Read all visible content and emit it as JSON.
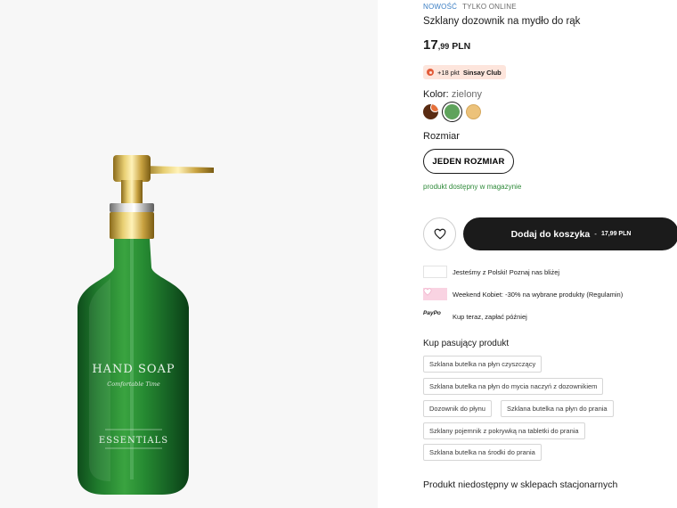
{
  "product": {
    "tag_new": "NOWOŚĆ",
    "tag_online": "TYLKO ONLINE",
    "title": "Szklany dozownik na mydło do rąk",
    "price_int": "17",
    "price_dec": ",99",
    "currency": "PLN",
    "points_text": "+18 pkt",
    "points_club": "Sinsay Club",
    "color_label": "Kolor:",
    "color_value": "zielony",
    "colors": [
      {
        "name": "brown",
        "hex": "#5a2b12"
      },
      {
        "name": "green",
        "hex": "#5fa35c",
        "selected": true
      },
      {
        "name": "sand",
        "hex": "#ecc27a"
      }
    ],
    "size_label": "Rozmiar",
    "size_option": "JEDEN ROZMIAR",
    "stock_text": "produkt dostępny w magazynie",
    "cart_label": "Dodaj do koszyka",
    "cart_separator": "-",
    "cart_price": "17,99 PLN",
    "unavailable_text": "Produkt niedostępny w sklepach stacjonarnych"
  },
  "image": {
    "label_main": "HAND SOAP",
    "label_sub": "Comfortable Time",
    "label_bottom": "ESSENTIALS"
  },
  "promos": [
    {
      "icon": "poland-flag-icon",
      "text": "Jesteśmy z Polski! Poznaj nas bliżej"
    },
    {
      "icon": "heart-gift-icon",
      "text": "Weekend Kobiet: -30% na wybrane produkty (Regulamin)"
    },
    {
      "icon": "paypo-logo-icon",
      "logo": "PayPo",
      "text": "Kup teraz, zapłać później"
    }
  ],
  "matching": {
    "title": "Kup pasujący produkt",
    "items": [
      "Szklana butelka na płyn czyszczący",
      "Szklana butelka na płyn do mycia naczyń z dozownikiem",
      "Dozownik do płynu",
      "Szklana butelka na płyn do prania",
      "Szklany pojemnik z pokrywką na tabletki do prania",
      "Szklana butelka na środki do prania"
    ]
  }
}
